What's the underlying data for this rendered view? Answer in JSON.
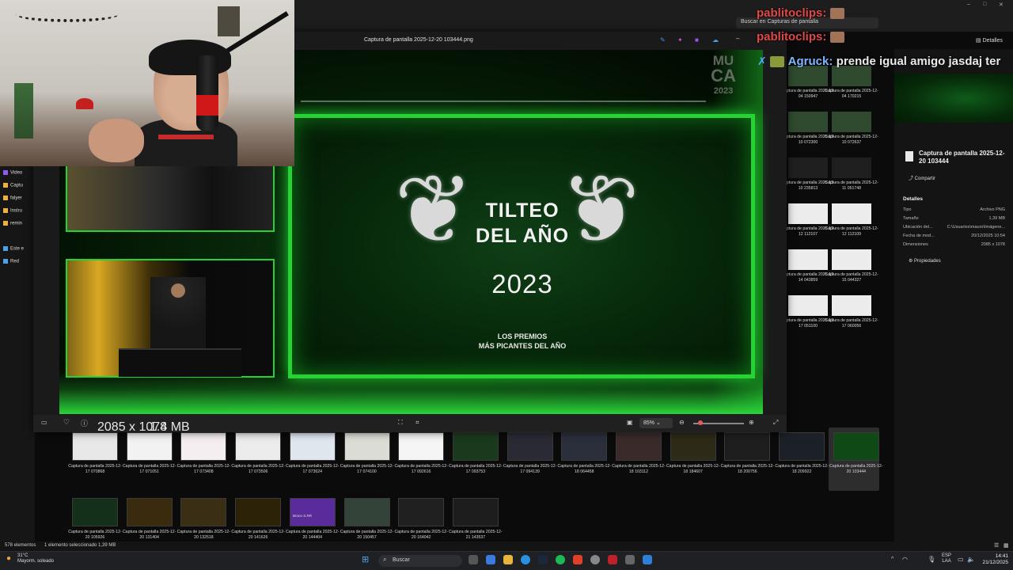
{
  "explorer": {
    "search_placeholder": "Buscar en Capturas de pantalla",
    "details_label": "Detalles",
    "window_controls": {
      "minimize": "–",
      "maximize": "□",
      "close": "✕"
    },
    "nav_items": [
      "Video",
      "Captu",
      "falyer",
      "Instru",
      "remin",
      "Este e",
      "Red"
    ],
    "status_left": "578 elementos",
    "status_selected": "1 elemento seleccionado  1,39 MB"
  },
  "viewer": {
    "title": "Captura de pantalla 2025-12-20 103444.png",
    "image": {
      "award_title_1": "TILTEO",
      "award_title_2": "DEL AÑO",
      "award_year": "2023",
      "award_sub_1": "LOS PREMIOS",
      "award_sub_2": "MÁS PICANTES DEL AÑO",
      "mini_logo_1": "MU",
      "mini_logo_2": "CA",
      "mini_logo_3": "2023"
    },
    "toolbar": {
      "resolution": "2085 x 1078",
      "size": "1.4 MB",
      "zoom": "85%"
    }
  },
  "thumbnails_row1": [
    {
      "caption": "Captura de pantalla 2025-12-17 070868",
      "color": "#e8e8e8"
    },
    {
      "caption": "Captura de pantalla 2025-12-17 071051",
      "color": "#f2f2f2"
    },
    {
      "caption": "Captura de pantalla 2025-12-17 073408",
      "color": "#f4eef0"
    },
    {
      "caption": "Captura de pantalla 2025-12-17 073506",
      "color": "#ececec"
    },
    {
      "caption": "Captura de pantalla 2025-12-17 073624",
      "color": "#dfe6ee"
    },
    {
      "caption": "Captura de pantalla 2025-12-17 074100",
      "color": "#dcdcd6"
    },
    {
      "caption": "Captura de pantalla 2025-12-17 092616",
      "color": "#f5f5f5"
    },
    {
      "caption": "Captura de pantalla 2025-12-17 093753",
      "color": "#1a3a1e"
    },
    {
      "caption": "Captura de pantalla 2025-12-17 094139",
      "color": "#2a2a35"
    },
    {
      "caption": "Captura de pantalla 2025-12-18 064458",
      "color": "#2b2f3c"
    },
    {
      "caption": "Captura de pantalla 2025-12-18 103112",
      "color": "#3b2a2a"
    },
    {
      "caption": "Captura de pantalla 2025-12-18 184607",
      "color": "#2e2a18"
    },
    {
      "caption": "Captura de pantalla 2025-12-18 200756",
      "color": "#1e1e1e"
    },
    {
      "caption": "Captura de pantalla 2025-12-18 209922",
      "color": "#1c2027"
    },
    {
      "caption": "Captura de pantalla 2025-12-20 103444",
      "color": "#0f4a16"
    }
  ],
  "thumbnails_row2": [
    {
      "caption": "Captura de pantalla 2025-12-20 105926",
      "color": "#15301a"
    },
    {
      "caption": "Captura de pantalla 2025-12-20 131404",
      "color": "#3a2a0e"
    },
    {
      "caption": "Captura de pantalla 2025-12-20 132518",
      "color": "#3a2e14"
    },
    {
      "caption": "Captura de pantalla 2025-12-20 141626",
      "color": "#2c2208"
    },
    {
      "caption": "Captura de pantalla 2025-12-20 144404",
      "color": "#5a2b9a"
    },
    {
      "caption": "Captura de pantalla 2025-12-20 150457",
      "color": "#33433a"
    },
    {
      "caption": "Captura de pantalla 2025-12-20 164042",
      "color": "#202020"
    },
    {
      "caption": "Captura de pantalla 2025-12-21 143537",
      "color": "#1d1d1d"
    }
  ],
  "thumbnail_text": {
    "avatar_name": "Bruno S.RR"
  },
  "right_grid": [
    {
      "caption": "Captura de pantalla 2025-12-04 150947"
    },
    {
      "caption": "Captura de pantalla 2025-12-04 170215"
    },
    {
      "caption": "Captura de pantalla 2025-12-10 072300"
    },
    {
      "caption": "Captura de pantalla 2025-12-10 072637"
    },
    {
      "caption": "Captura de pantalla 2025-12-10 235813"
    },
    {
      "caption": "Captura de pantalla 2025-12-11 051748"
    },
    {
      "caption": "Captura de pantalla 2025-12-12 112107"
    },
    {
      "caption": "Captura de pantalla 2025-12-12 112109"
    },
    {
      "caption": "Captura de pantalla 2025-12-14 043859"
    },
    {
      "caption": "Captura de pantalla 2025-12-15 044327"
    },
    {
      "caption": "Captura de pantalla 2025-12-17 051100"
    },
    {
      "caption": "Captura de pantalla 2025-12-17 060056"
    }
  ],
  "details": {
    "file_title": "Captura de pantalla 2025-12-20 103444",
    "share_label": "Compartir",
    "heading": "Detalles",
    "rows": [
      {
        "key": "Tipo",
        "value": "Archivo PNG"
      },
      {
        "key": "Tamaño",
        "value": "1,39 MB"
      },
      {
        "key": "Ubicación del...",
        "value": "C:\\Usuarios\\mauro\\Imágene..."
      },
      {
        "key": "Fecha de mod...",
        "value": "20/12/2025 10:54"
      },
      {
        "key": "Dimensiones",
        "value": "2085 x 1078"
      }
    ],
    "properties_label": "Propiedades"
  },
  "chat": {
    "messages": [
      {
        "user": "pablitoclips:",
        "text": ""
      },
      {
        "user": "pablitoclips:",
        "text": ""
      },
      {
        "user": "Agruck:",
        "text": "prende igual amigo jasdaj ter"
      }
    ]
  },
  "taskbar": {
    "search_label": "Buscar",
    "weather_temp": "31°C",
    "weather_desc": "Mayorm. soleado",
    "lang_1": "ESP",
    "lang_2": "LAA",
    "time": "14:41",
    "date": "21/12/2025"
  },
  "colors": {
    "accent_green": "#25d334",
    "chat_name": "#e04848"
  }
}
